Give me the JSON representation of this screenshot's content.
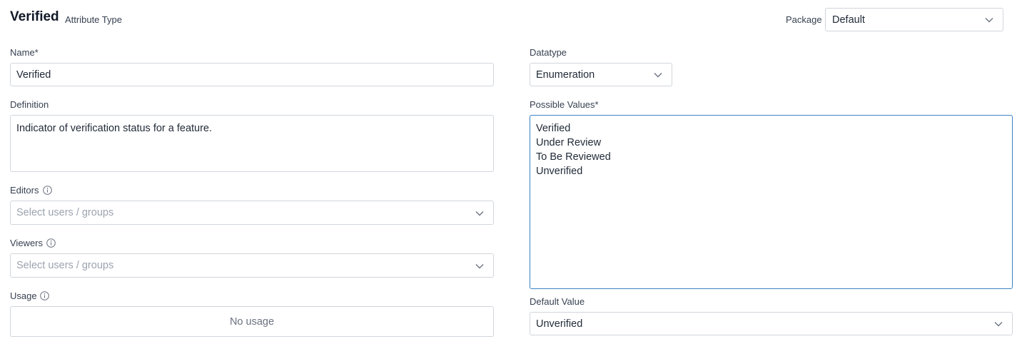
{
  "header": {
    "title": "Verified",
    "subtitle": "Attribute Type",
    "package_label": "Package",
    "package_value": "Default"
  },
  "form": {
    "name_label": "Name*",
    "name_value": "Verified",
    "definition_label": "Definition",
    "definition_value": "Indicator of verification status for a feature.",
    "editors_label": "Editors",
    "editors_placeholder": "Select users / groups",
    "viewers_label": "Viewers",
    "viewers_placeholder": "Select users / groups",
    "usage_label": "Usage",
    "usage_value": "No usage",
    "datatype_label": "Datatype",
    "datatype_value": "Enumeration",
    "possible_values_label": "Possible Values*",
    "possible_values": [
      "Verified",
      "Under Review",
      "To Be Reviewed",
      "Unverified"
    ],
    "default_value_label": "Default Value",
    "default_value": "Unverified"
  },
  "icons": {
    "dropdown": "chevron-down-icon",
    "info": "info-icon"
  },
  "colors": {
    "border": "#d1d5db",
    "focus_border": "#3b82c4",
    "placeholder": "#9ca3af",
    "text": "#1f2937"
  }
}
